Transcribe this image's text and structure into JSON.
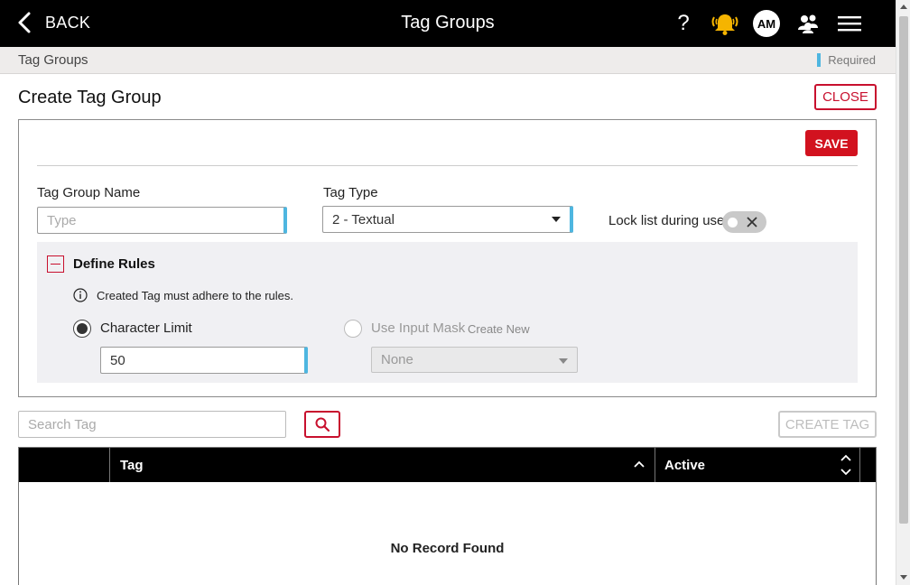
{
  "header": {
    "back_label": "BACK",
    "title": "Tag Groups",
    "help_glyph": "?",
    "avatar_initials": "AM",
    "icons": [
      "chevron-left-icon",
      "help-icon",
      "alarm-bell-icon",
      "avatar",
      "users-icon",
      "menu-icon"
    ],
    "alarm_color": "#f5b400"
  },
  "breadcrumb": {
    "current": "Tag Groups",
    "required_label": "Required",
    "required_color": "#4eb6e0"
  },
  "page": {
    "title": "Create Tag Group",
    "close_label": "CLOSE"
  },
  "form": {
    "save_label": "SAVE",
    "tag_group_name": {
      "label": "Tag Group Name",
      "value": "",
      "placeholder": "Type"
    },
    "tag_type": {
      "label": "Tag Type",
      "selected": "2 - Textual"
    },
    "lock_list": {
      "label": "Lock list during use",
      "enabled": false
    }
  },
  "rules": {
    "title": "Define Rules",
    "info_text": "Created Tag must adhere to the rules.",
    "character_limit": {
      "label": "Character Limit",
      "selected": true,
      "value": "50"
    },
    "input_mask": {
      "label": "Use Input Mask",
      "create_new_label": "Create New",
      "selected": false,
      "value": "None"
    }
  },
  "search": {
    "placeholder": "Search Tag",
    "create_tag_label": "CREATE TAG"
  },
  "table": {
    "columns": [
      "",
      "Tag",
      "Active"
    ],
    "rows": [],
    "empty_message": "No Record Found"
  },
  "colors": {
    "accent_red": "#c8102e",
    "save_red": "#d2121f",
    "header_bg": "#000000"
  }
}
